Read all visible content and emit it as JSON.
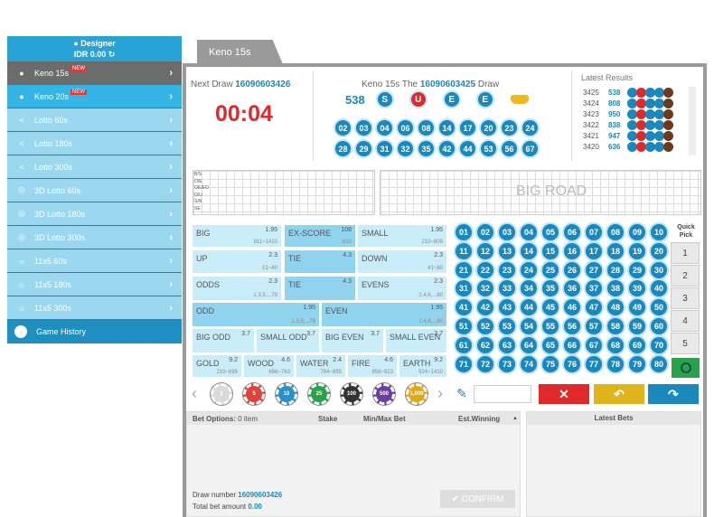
{
  "user": {
    "name": "Designer",
    "balance": "IDR 0.00"
  },
  "sidebar": [
    {
      "label": "Keno 15s",
      "badge": "NEW",
      "icon": "keno-icon",
      "state": "dark"
    },
    {
      "label": "Keno 20s",
      "badge": "NEW",
      "icon": "keno-icon",
      "state": "sel"
    },
    {
      "label": "Lotto 60s",
      "icon": "share-icon"
    },
    {
      "label": "Lotto 180s",
      "icon": "share-icon"
    },
    {
      "label": "Lotto 300s",
      "icon": "share-icon"
    },
    {
      "label": "3D Lotto 60s",
      "icon": "target-icon"
    },
    {
      "label": "3D Lotto 180s",
      "icon": "target-icon"
    },
    {
      "label": "3D Lotto 300s",
      "icon": "target-icon"
    },
    {
      "label": "11x5 60s",
      "icon": "sun-icon"
    },
    {
      "label": "11x5 180s",
      "icon": "sun-icon"
    },
    {
      "label": "11x5 300s",
      "icon": "sun-icon"
    }
  ],
  "history_label": "Game History",
  "tab": "Keno 15s",
  "next_draw": {
    "label": "Next Draw",
    "number": "16090603426",
    "countdown": "00:04"
  },
  "current": {
    "title_pre": "Keno 15s The",
    "number": "16090603425",
    "title_post": "Draw",
    "total": "538",
    "badges": [
      "S",
      "U",
      "E",
      "E"
    ],
    "balls": [
      "02",
      "03",
      "04",
      "06",
      "08",
      "14",
      "17",
      "20",
      "23",
      "24",
      "28",
      "29",
      "31",
      "32",
      "35",
      "42",
      "44",
      "53",
      "56",
      "67"
    ]
  },
  "latest": {
    "title": "Latest Results",
    "rows": [
      {
        "n": "3425",
        "t": "538"
      },
      {
        "n": "3424",
        "t": "808"
      },
      {
        "n": "3423",
        "t": "950"
      },
      {
        "n": "3422",
        "t": "838"
      },
      {
        "n": "3421",
        "t": "947"
      },
      {
        "n": "3420",
        "t": "636"
      }
    ]
  },
  "road_watermark": "BIG ROAD",
  "road_labels": [
    "B/S",
    "O/E",
    "OE/EO",
    "O/U",
    "S/N",
    "SE"
  ],
  "bets": [
    {
      "t": "BIG",
      "o": "1.95",
      "r": "811~1410"
    },
    {
      "t": "EX-SCORE",
      "o": "108",
      "r": "810"
    },
    {
      "t": "SMALL",
      "o": "1.95",
      "r": "210~809"
    },
    {
      "t": "UP",
      "o": "2.3",
      "r": "01~40"
    },
    {
      "t": "TIE",
      "o": "4.3",
      "r": ""
    },
    {
      "t": "DOWN",
      "o": "2.3",
      "r": "41~80"
    },
    {
      "t": "ODDS",
      "o": "2.3",
      "r": "1,3,5,...79"
    },
    {
      "t": "TIE",
      "o": "4.3",
      "r": ""
    },
    {
      "t": "EVENS",
      "o": "2.3",
      "r": "2,4,6,...80"
    },
    {
      "t": "ODD",
      "o": "1.95",
      "r": "1,3,5,...79"
    },
    {
      "t": "EVEN",
      "o": "1.95",
      "r": "2,4,6,...80"
    },
    {
      "t": "BIG ODD",
      "o": "3.7",
      "r": ""
    },
    {
      "t": "SMALL ODD",
      "o": "3.7",
      "r": ""
    },
    {
      "t": "BIG EVEN",
      "o": "3.7",
      "r": ""
    },
    {
      "t": "SMALL EVEN",
      "o": "3.7",
      "r": ""
    },
    {
      "t": "GOLD",
      "o": "9.2",
      "r": "210~695"
    },
    {
      "t": "WOOD",
      "o": "4.6",
      "r": "696~763"
    },
    {
      "t": "WATER",
      "o": "2.4",
      "r": "764~855"
    },
    {
      "t": "FIRE",
      "o": "4.6",
      "r": "856~923"
    },
    {
      "t": "EARTH",
      "o": "9.2",
      "r": "924~1410"
    }
  ],
  "quick_pick": {
    "label": "Quick Pick",
    "options": [
      "1",
      "2",
      "3",
      "4",
      "5"
    ]
  },
  "chips": [
    {
      "v": "1",
      "c": "#d9d9d9"
    },
    {
      "v": "5",
      "c": "#e2413b"
    },
    {
      "v": "10",
      "c": "#2a90c8"
    },
    {
      "v": "25",
      "c": "#2aa24a"
    },
    {
      "v": "100",
      "c": "#333333"
    },
    {
      "v": "500",
      "c": "#6a3ea1"
    },
    {
      "v": "1,000",
      "c": "#e0a91c"
    }
  ],
  "colors": {
    "accent": "#1b88bd",
    "cancel": "#e02a2a",
    "undo": "#e0b41c",
    "repeat": "#1b88bd",
    "quick_confirm": "#2aa24a"
  },
  "bet_table": {
    "options_label": "Bet Options:",
    "options_count": "0 item",
    "stake": "Stake",
    "minmax": "Min/Max Bet",
    "est": "Est.Winning",
    "latest_bets": "Latest Bets",
    "draw_label": "Draw number",
    "draw_number": "16090603426",
    "total_label": "Total bet amount",
    "total": "0.00",
    "confirm": "CONFIRM"
  }
}
